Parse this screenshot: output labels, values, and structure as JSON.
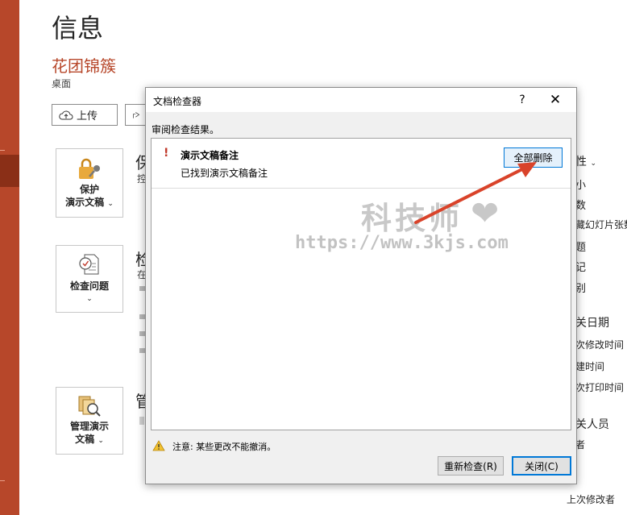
{
  "backstage": {
    "page_title": "信息",
    "file_name": "花团锦簇",
    "file_location": "桌面",
    "upload_label": "上传",
    "protect": {
      "tile_label_line1": "保护",
      "tile_label_line2": "演示文稿",
      "heading": "保",
      "desc": "控"
    },
    "inspect": {
      "tile_label": "检查问题",
      "heading": "检",
      "desc": "在"
    },
    "manage": {
      "tile_label_line1": "管理演示",
      "tile_label_line2": "文稿",
      "heading": "管"
    }
  },
  "properties": {
    "heading": "性",
    "rows": [
      "小",
      "数",
      "藏幻灯片张数",
      "题",
      "记",
      "别"
    ],
    "dates_heading": "关日期",
    "dates": [
      "次修改时间",
      "建时间",
      "次打印时间"
    ],
    "people_heading": "关人员",
    "people": [
      "者"
    ],
    "last_modified_by": "上次修改者"
  },
  "dialog": {
    "title": "文档检查器",
    "help_glyph": "?",
    "close_glyph": "✕",
    "instructions": "审阅检查结果。",
    "result": {
      "mark": "!",
      "title": "演示文稿备注",
      "description": "已找到演示文稿备注",
      "remove_all_label": "全部删除"
    },
    "warning_text": "注意: 某些更改不能撤消。",
    "reinspect_label": "重新检查(R)",
    "close_label": "关闭(C)"
  },
  "watermark": {
    "title": "科技师",
    "heart": "❤",
    "url": "https://www.3kjs.com"
  },
  "colors": {
    "accent": "#b7472a",
    "selection_blue": "#0078d7",
    "annotation_arrow": "#d9432a"
  },
  "icons": [
    "cloud-upload-icon",
    "share-icon",
    "lock-key-icon",
    "document-check-icon",
    "manage-versions-icon",
    "warning-icon",
    "close-icon",
    "help-icon"
  ]
}
